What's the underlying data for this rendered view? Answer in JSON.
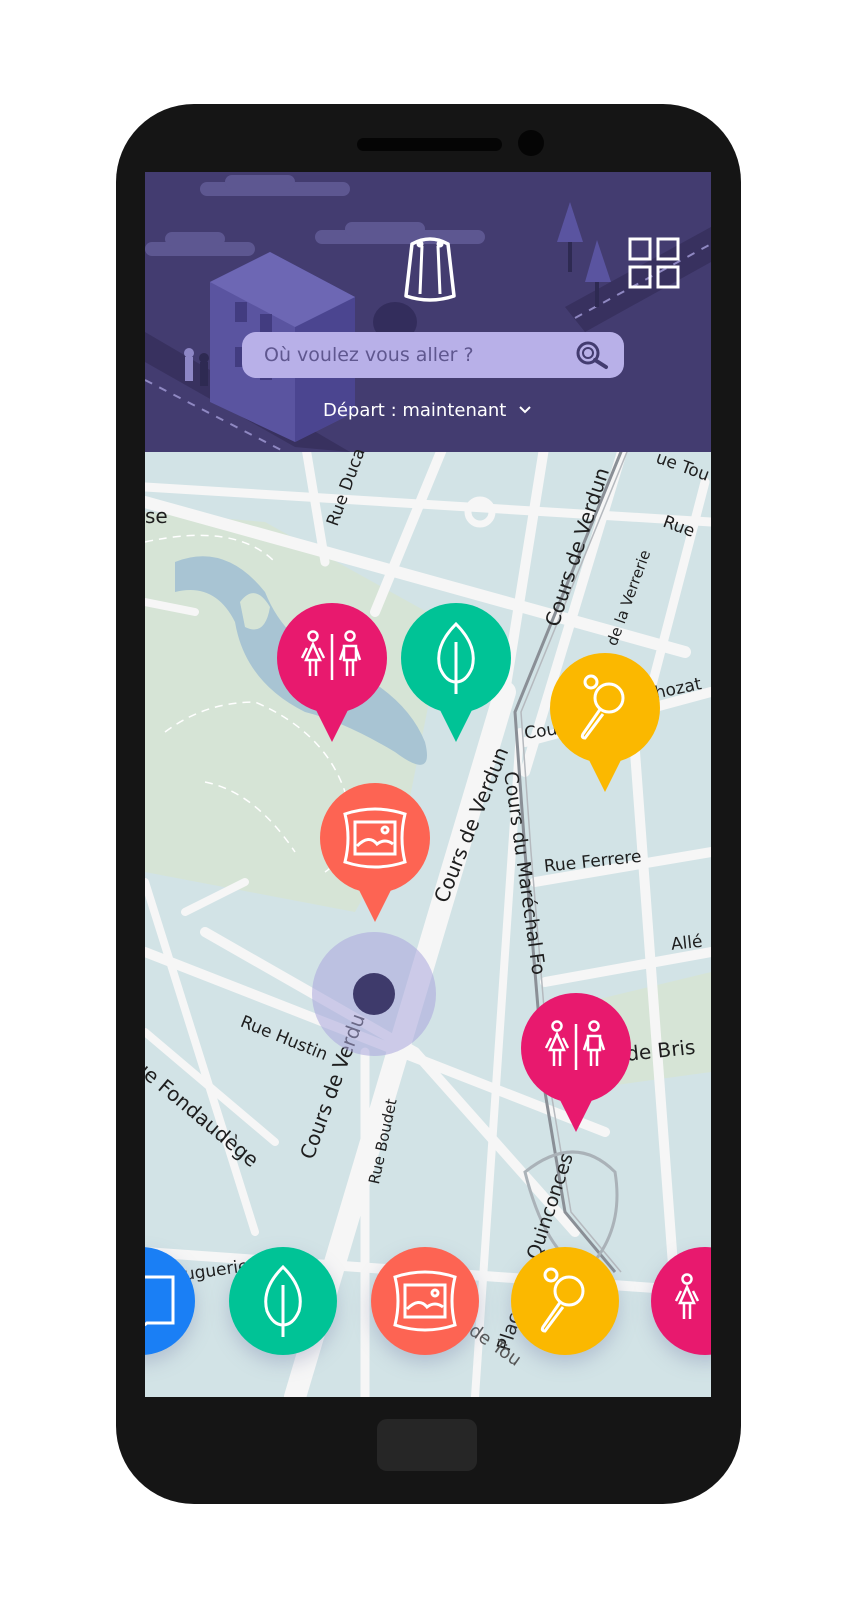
{
  "header": {
    "search_placeholder": "Où voulez vous aller ?",
    "depart_label": "Départ : maintenant"
  },
  "map": {
    "streets": [
      "Rue Duca",
      "Cours de Verdun",
      "Rue",
      "ue Tou",
      "de la Verrerie",
      "Cou",
      "hozat",
      "Cours de Verdun",
      "Cours du Maréchal Fo",
      "Rue Ferrere",
      "Allé",
      "de Bris",
      "Rue Hustin",
      "Cours de Verdu",
      "Rue Boudet",
      "ue Fondaudège",
      "Huguerie",
      "Place des Quinconces",
      "de Tou",
      "se"
    ]
  },
  "pins": [
    {
      "type": "toilets-icon",
      "color": "#e8196e"
    },
    {
      "type": "tree-icon",
      "color": "#00c396"
    },
    {
      "type": "ping-pong-icon",
      "color": "#fbb800"
    },
    {
      "type": "painting-icon",
      "color": "#fd6453"
    },
    {
      "type": "toilets-icon",
      "color": "#e8196e"
    }
  ],
  "categories": [
    {
      "type": "book-icon",
      "color": "#1a7ff5"
    },
    {
      "type": "tree-icon",
      "color": "#00c396"
    },
    {
      "type": "painting-icon",
      "color": "#fd6453"
    },
    {
      "type": "ping-pong-icon",
      "color": "#fbb800"
    },
    {
      "type": "toilets-icon",
      "color": "#e8196e"
    }
  ],
  "colors": {
    "header_bg": "#433c70",
    "search_bg": "#b8b0e8",
    "user_dot": "#3e3a6b",
    "map_water": "#d2e3e6",
    "map_park": "#d6e4d6"
  }
}
